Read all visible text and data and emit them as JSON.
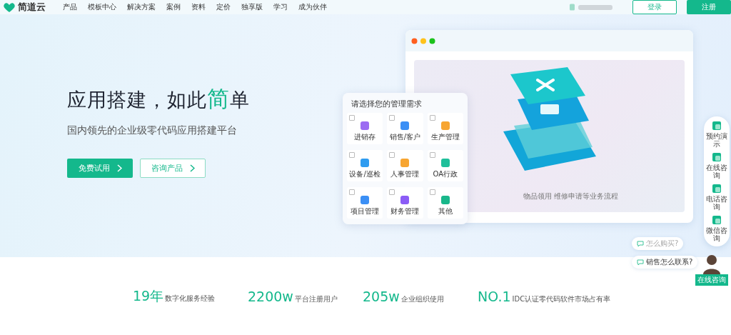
{
  "header": {
    "logo": "简道云",
    "nav": [
      {
        "label": "产品"
      },
      {
        "label": "模板中心"
      },
      {
        "label": "解决方案"
      },
      {
        "label": "案例"
      },
      {
        "label": "资料"
      },
      {
        "label": "定价"
      },
      {
        "label": "独享版"
      },
      {
        "label": "学习"
      },
      {
        "label": "成为伙伴"
      }
    ],
    "login": "登录",
    "register": "注册"
  },
  "hero": {
    "headline": [
      {
        "text": "应用搭建，如此",
        "highlight": false
      },
      {
        "text": "简",
        "highlight": true
      },
      {
        "text": "单",
        "highlight": false
      }
    ],
    "subtitle": "国内领先的企业级零代码应用搭建平台",
    "primary_button": "免费试用",
    "secondary_button": "咨询产品"
  },
  "preview": {
    "caption": "物品领用 维修申请等业务流程"
  },
  "needs_panel": {
    "title": "请选择您的管理需求",
    "items": [
      {
        "label": "进销存",
        "checked": false,
        "color": "#9b6bf2"
      },
      {
        "label": "销售/客户",
        "checked": false,
        "color": "#3b8ff5"
      },
      {
        "label": "生产管理",
        "checked": false,
        "color": "#f7a531"
      },
      {
        "label": "设备/巡检",
        "checked": false,
        "color": "#2f9cf0"
      },
      {
        "label": "人事管理",
        "checked": false,
        "color": "#f7a531"
      },
      {
        "label": "OA行政",
        "checked": false,
        "color": "#1fbf9a"
      },
      {
        "label": "项目管理",
        "checked": false,
        "color": "#3b8ff5"
      },
      {
        "label": "财务管理",
        "checked": false,
        "color": "#8b5cf6"
      },
      {
        "label": "其他",
        "checked": false,
        "color": "#19b78a"
      }
    ]
  },
  "side_bar": [
    {
      "label": "预约演示"
    },
    {
      "label": "在线咨询"
    },
    {
      "label": "电话咨询"
    },
    {
      "label": "微信咨询"
    }
  ],
  "chat": {
    "questions": [
      "怎么购买?",
      "销售怎么联系?"
    ],
    "agent_label": "在线咨询"
  },
  "stats": [
    {
      "value": "19年",
      "label": "数字化服务经验"
    },
    {
      "value": "2200w",
      "label": "平台注册用户"
    },
    {
      "value": "205w",
      "label": "企业组织使用"
    },
    {
      "value": "NO.1",
      "label": "IDC认证零代码软件市场占有率"
    }
  ]
}
